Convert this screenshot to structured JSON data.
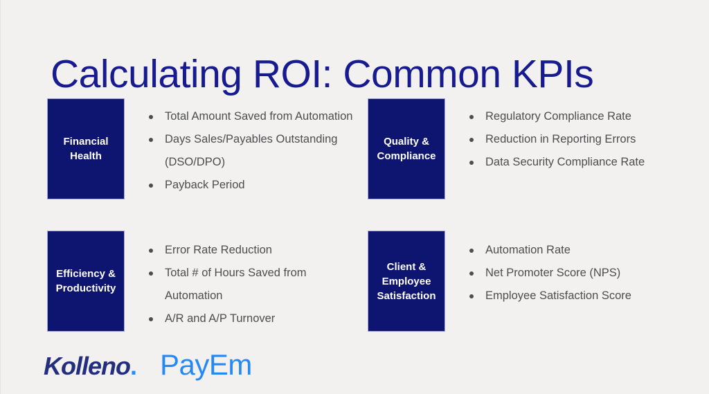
{
  "slide": {
    "title": "Calculating ROI: Common KPIs",
    "background_color": "#f2f1f0",
    "title_color": "#171b8f",
    "box_color": "#0d1570",
    "box_border_color": "#a7a9dd",
    "bullet_text_color": "#4d4d4d"
  },
  "quadrants": [
    {
      "category": "Financial\nHealth",
      "items": [
        "Total Amount Saved from Automation",
        "Days Sales/Payables Outstanding\n(DSO/DPO)",
        "Payback Period"
      ]
    },
    {
      "category": "Quality &\nCompliance",
      "items": [
        "Regulatory Compliance Rate",
        "Reduction in Reporting Errors",
        "Data Security Compliance Rate"
      ]
    },
    {
      "category": "Efficiency &\nProductivity",
      "items": [
        "Error Rate Reduction",
        "Total # of Hours Saved from\nAutomation",
        "A/R and A/P Turnover"
      ]
    },
    {
      "category": "Client &\nEmployee\nSatisfaction",
      "items": [
        "Automation Rate",
        "Net Promoter Score (NPS)",
        "Employee Satisfaction Score"
      ]
    }
  ],
  "footer": {
    "logos": [
      {
        "name": "Kolleno",
        "suffix": ".",
        "color": "#232f7c",
        "accent_color": "#2a8cf2"
      },
      {
        "name": "PayEm",
        "color": "#2589f5"
      }
    ]
  }
}
